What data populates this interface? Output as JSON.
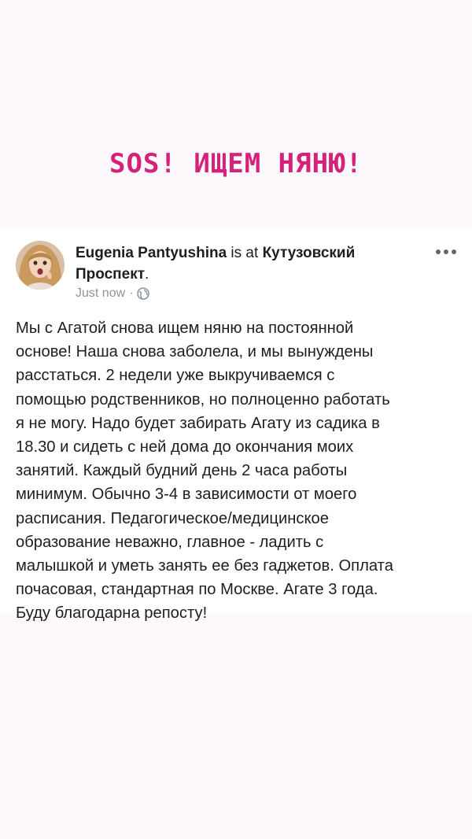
{
  "headline": "SOS! ИЩЕМ НЯНЮ!",
  "post": {
    "author": "Eugenia Pantyushina",
    "is_at": " is at ",
    "place": "Кутузовский Проспект",
    "place_suffix": ".",
    "timestamp": "Just now",
    "separator": " · ",
    "privacy_icon": "globe-icon",
    "menu_icon": "more-dots-icon",
    "body": "Мы с Агатой снова ищем няню на постоянной\nоснове! Наша снова заболела, и мы вынуждены\nрасстаться. 2 недели уже выкручиваемся с\nпомощью родственников, но полноценно работать\nя не могу. Надо будет забирать Агату из садика в\n18.30 и сидеть с ней дома до окончания моих\nзанятий. Каждый будний день 2 часа работы\nминимум. Обычно 3-4 в зависимости от моего\nрасписания. Педагогическое/медицинское\nобразование неважно, главное - ладить с\nмалышкой и уметь занять ее без гаджетов. Оплата\nпочасовая, стандартная по Москве. Агате 3 года.\nБуду благодарна репосту!"
  },
  "colors": {
    "headline": "#d4217a",
    "background": "#fdf8fb",
    "card": "#ffffff",
    "text": "#1c1e21",
    "meta": "#8d949e"
  }
}
